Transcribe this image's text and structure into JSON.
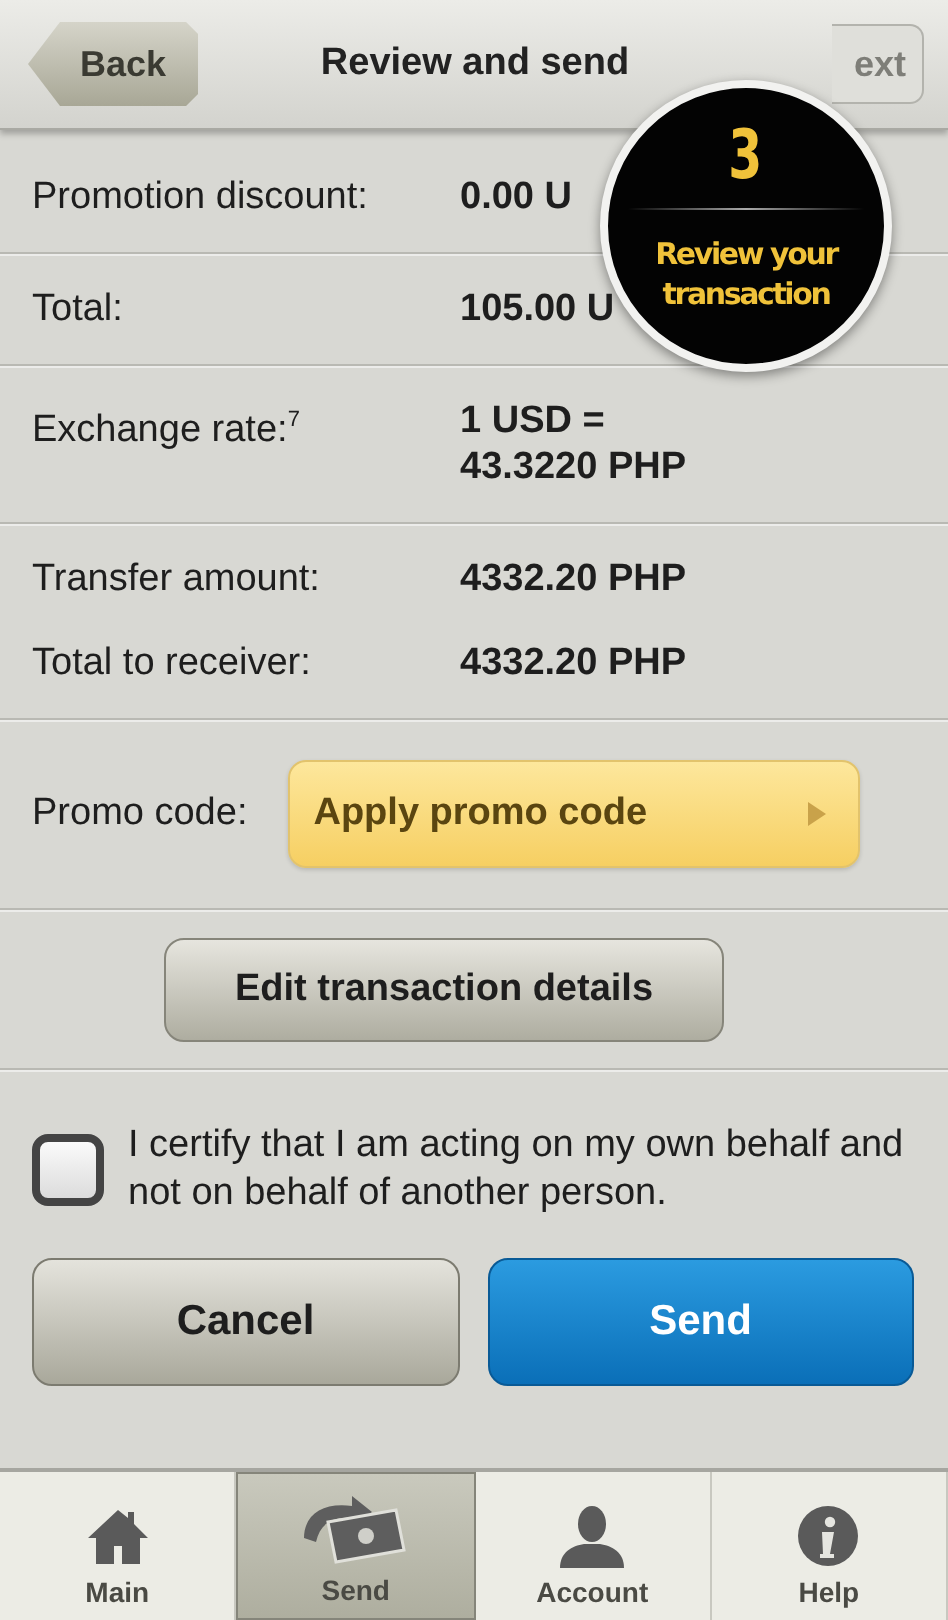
{
  "nav": {
    "back": "Back",
    "title": "Review and send",
    "next": "ext",
    "next_disabled": true
  },
  "step_badge": {
    "number": "3",
    "text": "Review your transaction"
  },
  "sections": [
    {
      "rows": [
        {
          "label": "Promotion discount:",
          "value": "0.00 U"
        }
      ]
    },
    {
      "rows": [
        {
          "label": "Total:",
          "value": "105.00 U"
        }
      ]
    },
    {
      "rows": [
        {
          "label": "Exchange rate:$^{7}$",
          "value": "1 USD =\n43.3220 PHP"
        }
      ]
    },
    {
      "rows": [
        {
          "label": "Transfer amount:",
          "value": "4332.20 PHP"
        },
        {
          "label": "Total to receiver:",
          "value": "4332.20 PHP"
        }
      ]
    }
  ],
  "promo": {
    "label": "Promo code:",
    "button": "Apply promo code"
  },
  "edit_button": "Edit transaction details",
  "certify": {
    "checked": false,
    "text": "I certify that I am acting on my own behalf and not on behalf of another person."
  },
  "actions": {
    "cancel": "Cancel",
    "send": "Send"
  },
  "tabs": [
    {
      "label": "Main",
      "kind": "home",
      "selected": false
    },
    {
      "label": "Send",
      "kind": "send",
      "selected": true
    },
    {
      "label": "Account",
      "kind": "person",
      "selected": false
    },
    {
      "label": "Help",
      "kind": "info",
      "selected": false
    }
  ]
}
